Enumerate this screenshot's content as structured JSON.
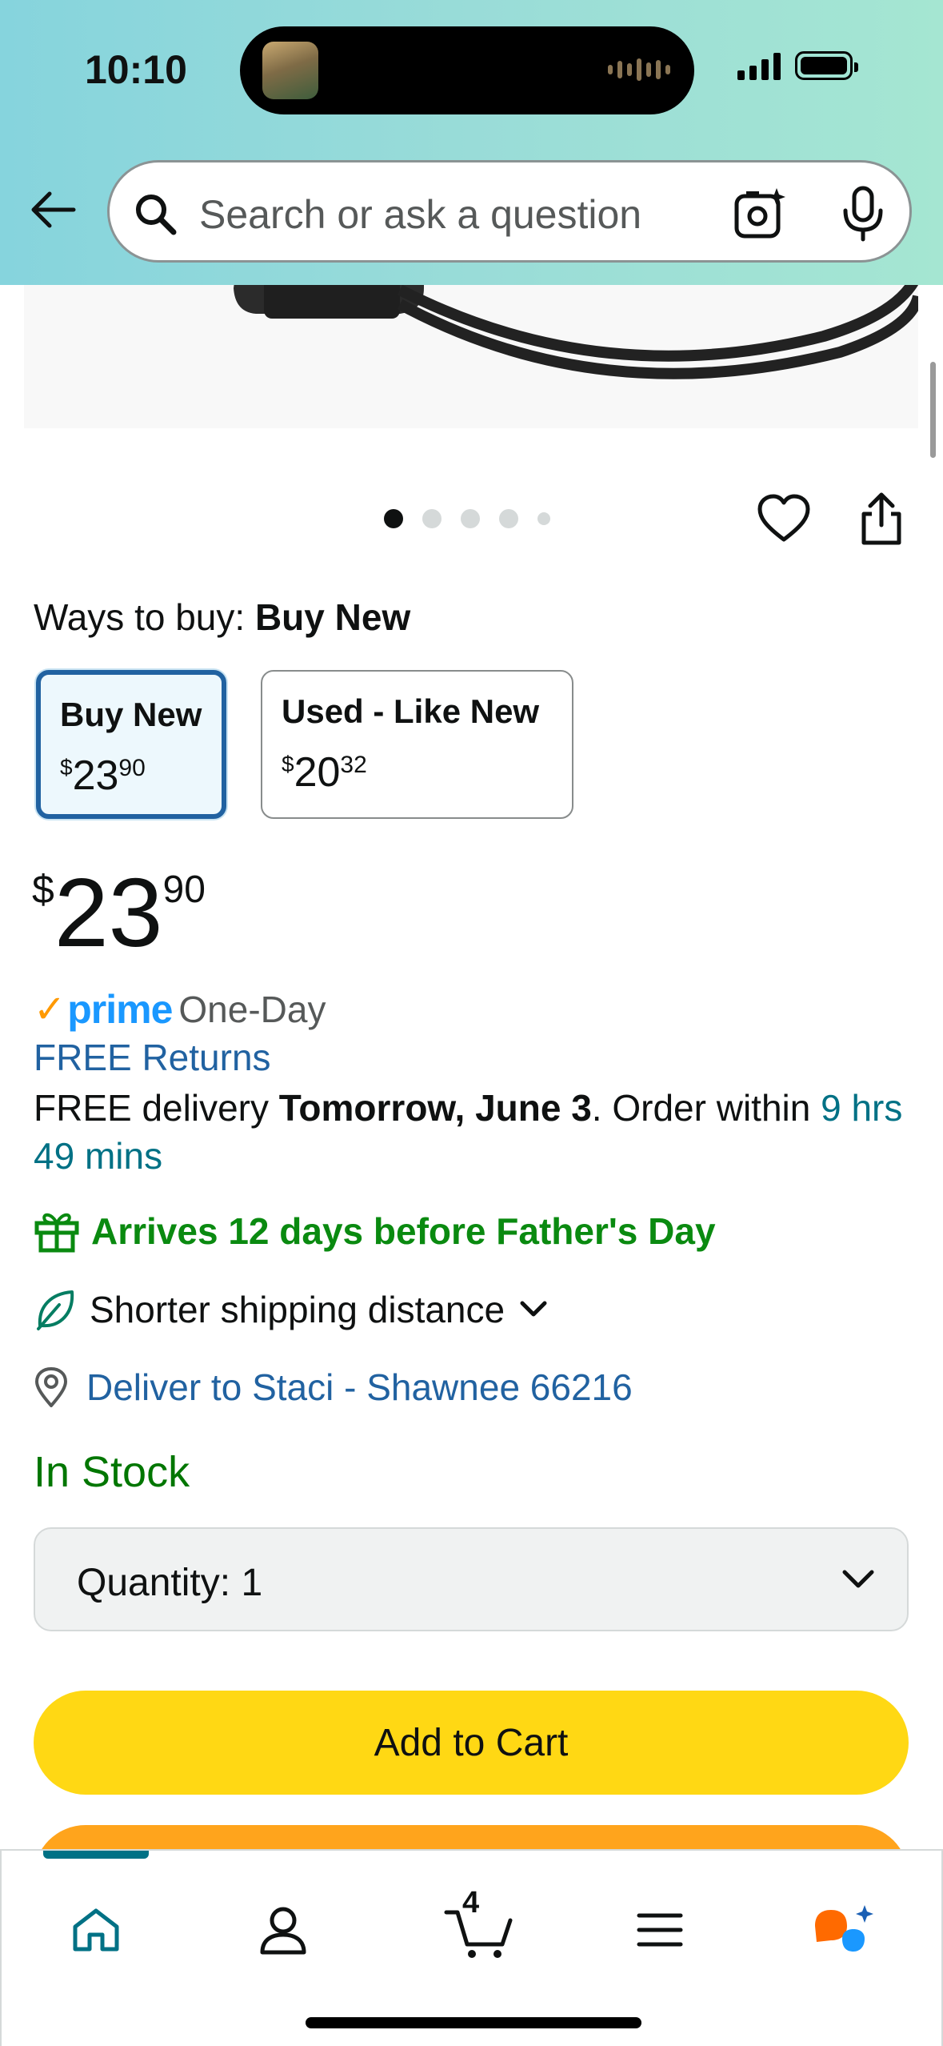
{
  "status_bar": {
    "time": "10:10"
  },
  "search": {
    "placeholder": "Search or ask a question"
  },
  "icons": {
    "back": "arrow-left-icon",
    "search": "search-icon",
    "lens": "camera-lens-icon",
    "mic": "microphone-icon",
    "heart": "heart-icon",
    "share": "share-icon",
    "gift": "gift-icon",
    "leaf": "leaf-icon",
    "location": "location-pin-icon",
    "chevron": "chevron-down-icon"
  },
  "carousel": {
    "total_dots": 5,
    "active_index": 0
  },
  "ways_to_buy": {
    "label": "Ways to buy: ",
    "selected": "Buy New",
    "options": [
      {
        "name": "Buy New",
        "currency": "$",
        "dollars": "23",
        "cents": "90",
        "selected": true
      },
      {
        "name": "Used - Like New",
        "currency": "$",
        "dollars": "20",
        "cents": "32",
        "selected": false
      }
    ]
  },
  "price": {
    "currency": "$",
    "dollars": "23",
    "cents": "90"
  },
  "prime": {
    "check": "✓",
    "logo": "prime",
    "speed": "One-Day"
  },
  "returns": "FREE Returns",
  "delivery": {
    "prefix": "FREE delivery ",
    "date": "Tomorrow, June 3",
    "middle": ". Order within ",
    "countdown": "9 hrs 49 mins"
  },
  "gift_message": "Arrives 12 days before Father's Day",
  "shipping_note": "Shorter shipping distance",
  "deliver_to": "Deliver to Staci - Shawnee 66216",
  "stock_status": "In Stock",
  "quantity": {
    "label": "Quantity:",
    "value": "1"
  },
  "buttons": {
    "add_to_cart": "Add to Cart"
  },
  "bottom_nav": {
    "items": [
      "home",
      "account",
      "cart",
      "menu",
      "rufus"
    ],
    "cart_count": "4",
    "active": "home"
  },
  "colors": {
    "accent_teal": "#007185",
    "link_blue": "#2162a1",
    "stock_green": "#007600",
    "gift_green": "#0a8a10",
    "add_to_cart_yellow": "#ffd814",
    "buy_now_orange": "#ffa41c",
    "prime_blue": "#1a98ff",
    "prime_check_orange": "#ff9900"
  }
}
